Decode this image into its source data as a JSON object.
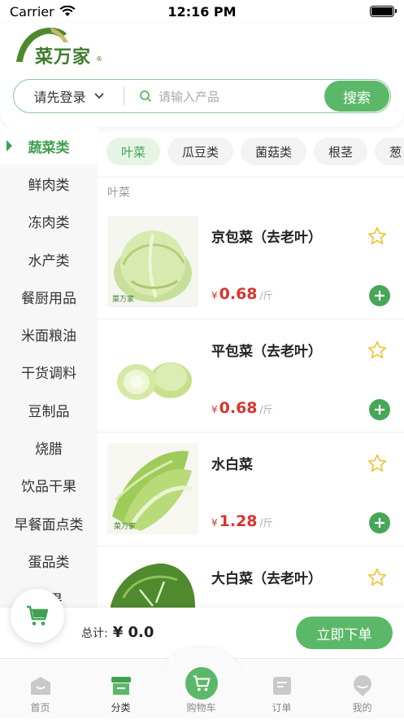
{
  "status": {
    "carrier": "Carrier",
    "time": "12:16 PM"
  },
  "logo": {
    "text": "菜万家",
    "reg": "®"
  },
  "search": {
    "login_label": "请先登录",
    "placeholder": "请输入产品",
    "button": "搜索"
  },
  "sidebar": {
    "items": [
      {
        "label": "蔬菜类",
        "active": true
      },
      {
        "label": "鲜肉类"
      },
      {
        "label": "冻肉类"
      },
      {
        "label": "水产类"
      },
      {
        "label": "餐厨用品"
      },
      {
        "label": "米面粮油"
      },
      {
        "label": "干货调料"
      },
      {
        "label": "豆制品"
      },
      {
        "label": "烧腊"
      },
      {
        "label": "饮品干果"
      },
      {
        "label": "早餐面点类"
      },
      {
        "label": "蛋品类"
      },
      {
        "label": "水果"
      }
    ]
  },
  "chips": [
    {
      "label": "叶菜",
      "active": true
    },
    {
      "label": "瓜豆类"
    },
    {
      "label": "菌菇类"
    },
    {
      "label": "根茎"
    },
    {
      "label": "葱"
    }
  ],
  "section_title": "叶菜",
  "products": [
    {
      "name": "京包菜（去老叶）",
      "currency": "¥",
      "price": "0.68",
      "unit": "/斤",
      "watermark": "菜万家"
    },
    {
      "name": "平包菜（去老叶）",
      "currency": "¥",
      "price": "0.68",
      "unit": "/斤",
      "watermark": ""
    },
    {
      "name": "水白菜",
      "currency": "¥",
      "price": "1.28",
      "unit": "/斤",
      "watermark": "菜万家"
    },
    {
      "name": "大白菜（去老叶）",
      "currency": "¥",
      "price": "",
      "unit": "",
      "watermark": ""
    }
  ],
  "cart": {
    "total_label": "总计:",
    "total_value": "¥ 0.0",
    "order_button": "立即下单"
  },
  "tabs": [
    {
      "label": "首页",
      "icon": "home-icon"
    },
    {
      "label": "分类",
      "icon": "category-icon",
      "active": true
    },
    {
      "label": "购物车",
      "icon": "cart-icon"
    },
    {
      "label": "订单",
      "icon": "order-icon"
    },
    {
      "label": "我的",
      "icon": "profile-icon"
    }
  ],
  "colors": {
    "brand_green": "#5cb869",
    "price_red": "#d8342e"
  }
}
